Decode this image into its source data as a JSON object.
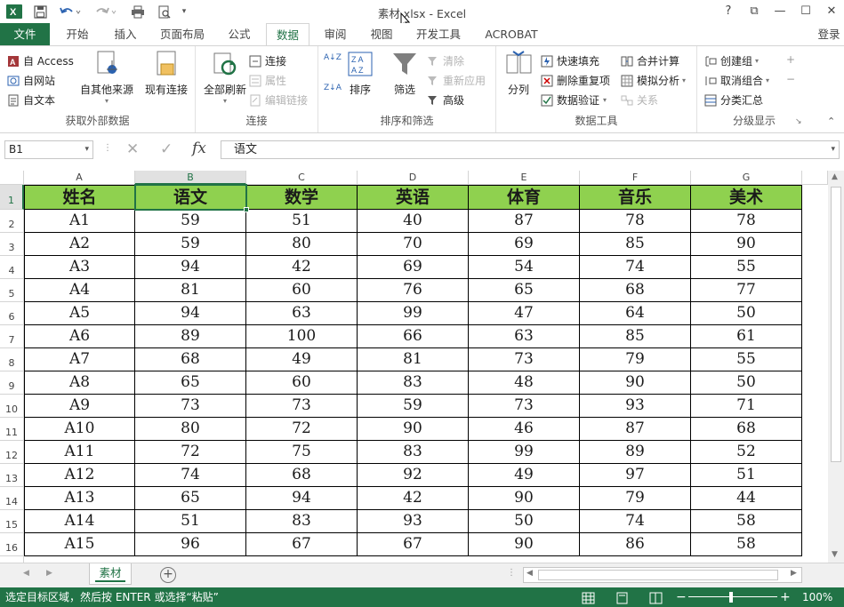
{
  "titlebar": {
    "title": "素材.xlsx - Excel",
    "help": "?",
    "restore_ribbon": "⧉",
    "minimize": "—",
    "maximize": "☐",
    "close": "✕"
  },
  "tabs": {
    "file": "文件",
    "home": "开始",
    "insert": "插入",
    "layout": "页面布局",
    "formulas": "公式",
    "data": "数据",
    "review": "审阅",
    "view": "视图",
    "developer": "开发工具",
    "acrobat": "ACROBAT",
    "login": "登录"
  },
  "ribbon": {
    "external": {
      "access": "自 Access",
      "web": "自网站",
      "text": "自文本",
      "other": "自其他来源",
      "existing": "现有连接",
      "label": "获取外部数据"
    },
    "connections": {
      "refresh_all": "全部刷新",
      "connections": "连接",
      "properties": "属性",
      "edit_links": "编辑链接",
      "label": "连接"
    },
    "sort_filter": {
      "sort": "排序",
      "filter": "筛选",
      "clear": "清除",
      "reapply": "重新应用",
      "advanced": "高级",
      "label": "排序和筛选",
      "az": "A↓Z",
      "za": "Z↓A"
    },
    "data_tools": {
      "split": "分列",
      "flash_fill": "快速填充",
      "remove_dup": "删除重复项",
      "validation": "数据验证",
      "consolidate": "合并计算",
      "whatif": "模拟分析",
      "relations": "关系",
      "label": "数据工具"
    },
    "outline": {
      "group": "创建组",
      "ungroup": "取消组合",
      "subtotal": "分类汇总",
      "label": "分级显示"
    }
  },
  "formula_bar": {
    "name_box": "B1",
    "content": "语文",
    "fx": "fx"
  },
  "columns": [
    "A",
    "B",
    "C",
    "D",
    "E",
    "F",
    "G"
  ],
  "header_row": [
    "姓名",
    "语文",
    "数学",
    "英语",
    "体育",
    "音乐",
    "美术"
  ],
  "rows": [
    [
      "A1",
      "59",
      "51",
      "40",
      "87",
      "78",
      "78"
    ],
    [
      "A2",
      "59",
      "80",
      "70",
      "69",
      "85",
      "90"
    ],
    [
      "A3",
      "94",
      "42",
      "69",
      "54",
      "74",
      "55"
    ],
    [
      "A4",
      "81",
      "60",
      "76",
      "65",
      "68",
      "77"
    ],
    [
      "A5",
      "94",
      "63",
      "99",
      "47",
      "64",
      "50"
    ],
    [
      "A6",
      "89",
      "100",
      "66",
      "63",
      "85",
      "61"
    ],
    [
      "A7",
      "68",
      "49",
      "81",
      "73",
      "79",
      "55"
    ],
    [
      "A8",
      "65",
      "60",
      "83",
      "48",
      "90",
      "50"
    ],
    [
      "A9",
      "73",
      "73",
      "59",
      "73",
      "93",
      "71"
    ],
    [
      "A10",
      "80",
      "72",
      "90",
      "46",
      "87",
      "68"
    ],
    [
      "A11",
      "72",
      "75",
      "83",
      "99",
      "89",
      "52"
    ],
    [
      "A12",
      "74",
      "68",
      "92",
      "49",
      "97",
      "51"
    ],
    [
      "A13",
      "65",
      "94",
      "42",
      "90",
      "79",
      "44"
    ],
    [
      "A14",
      "51",
      "83",
      "93",
      "50",
      "74",
      "58"
    ],
    [
      "A15",
      "96",
      "67",
      "67",
      "90",
      "86",
      "58"
    ]
  ],
  "row_numbers": [
    "1",
    "2",
    "3",
    "4",
    "5",
    "6",
    "7",
    "8",
    "9",
    "10",
    "11",
    "12",
    "13",
    "14",
    "15",
    "16"
  ],
  "sheet": {
    "name": "素材",
    "add": "+"
  },
  "status": {
    "message": "选定目标区域，然后按 ENTER 或选择“粘贴”",
    "zoom": "100%",
    "zoom_minus": "−",
    "zoom_plus": "+"
  },
  "colors": {
    "accent": "#217346",
    "header_fill": "#8fd14f"
  }
}
